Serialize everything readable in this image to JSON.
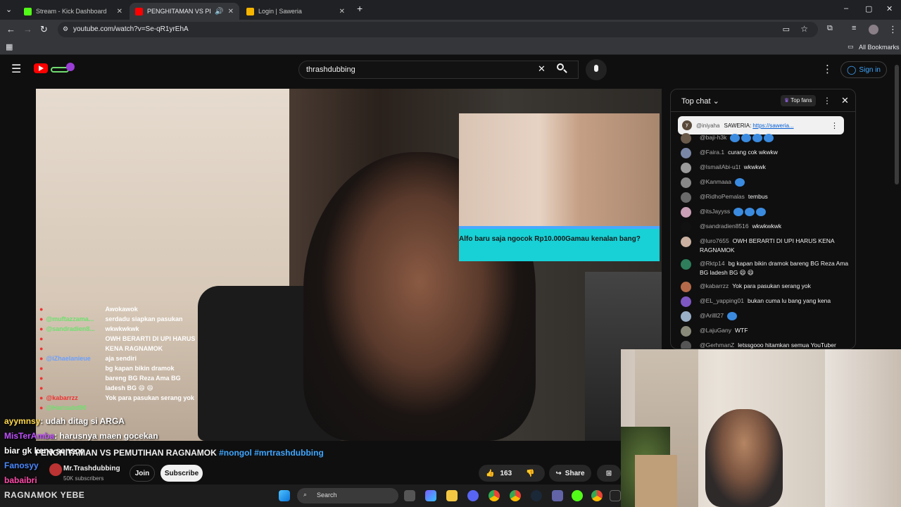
{
  "browser": {
    "tabs": [
      {
        "label": "Stream - Kick Dashboard",
        "color": "#53fc18"
      },
      {
        "label": "PENGHITAMAN VS PEMUTI",
        "color": "#ff0000"
      },
      {
        "label": "Login | Saweria",
        "color": "#f4b400"
      }
    ],
    "url": "youtube.com/watch?v=Se-qR1yrEhA",
    "bookmarks_label": "All Bookmarks"
  },
  "youtube": {
    "search_query": "thrashdubbing",
    "sign_in": "Sign in"
  },
  "video": {
    "alert_message_line1": "Alfo baru saja ngocok Rp10.000",
    "alert_message_line2": "Gamau kenalan bang?",
    "alert_progress_percent": 100,
    "overlay_chat": [
      {
        "user": "",
        "text": "Awokawok",
        "color": "red"
      },
      {
        "user": "@muftazzama...",
        "text": "serdadu siapkan pasukan",
        "color": "green"
      },
      {
        "user": "@sandradien8...",
        "text": "wkwkwkwk",
        "color": "green"
      },
      {
        "user": "",
        "text": "OWH BERARTI DI UPI HARUS",
        "color": "red"
      },
      {
        "user": "",
        "text": "KENA RAGNAMOK",
        "color": "red"
      },
      {
        "user": "@iZhaelanieue",
        "text": "aja sendiri",
        "color": "blue"
      },
      {
        "user": "",
        "text": "bg kapan bikin dramok",
        "color": "red"
      },
      {
        "user": "",
        "text": "bareng BG Reza Ama BG",
        "color": "red"
      },
      {
        "user": "",
        "text": "ladesh BG 😄 😄",
        "color": "red"
      },
      {
        "user": "@kabarrzz",
        "text": "Yok para pasukan serang yok",
        "color": "red"
      },
      {
        "user": "@Harisabd90",
        "text": "",
        "color": "green"
      }
    ],
    "big_chat": [
      {
        "user": "ayymnsy",
        "text": "udah ditag si ARGA"
      },
      {
        "user": "MisTerAmba",
        "text": "harusnya maen gocekan"
      },
      {
        "user": "",
        "text": "biar gk kena sensor"
      },
      {
        "user": "Fanosyy",
        "text": ""
      },
      {
        "user": "babaibri",
        "text": ""
      }
    ],
    "ticker": "RAGNAMOK YEBE"
  },
  "meta": {
    "title": "PENGHITAMAN VS PEMUTIHAN RAGNAMOK",
    "hashtags": "#nongol #mrtrashdubbing",
    "channel": "Mr.Trashdubbing",
    "subscribers": "50K subscribers",
    "join": "Join",
    "subscribe": "Subscribe",
    "likes": "163",
    "share": "Share"
  },
  "chat": {
    "header": "Top chat",
    "top_fans": "Top fans",
    "pinned_user": "@iniyaha",
    "pinned_prefix": "SAWERIA:",
    "pinned_link": "https://saweria...",
    "messages": [
      {
        "user": "@baji-h3k",
        "text": "",
        "emotes": 4,
        "avatar": "#6a5a4a"
      },
      {
        "user": "@Faira.1",
        "text": "curang cok wkwkw",
        "emotes": 0,
        "avatar": "#7a86a6"
      },
      {
        "user": "@IsmailAbi-u1t",
        "text": "wkwkwk",
        "emotes": 0,
        "avatar": "#9a9a9a"
      },
      {
        "user": "@Kanmaaa",
        "text": "",
        "emotes": 1,
        "avatar": "#888"
      },
      {
        "user": "@RidhoPemalas",
        "text": "tembus",
        "emotes": 0,
        "avatar": "#6a6a6a"
      },
      {
        "user": "@itsJayyss",
        "text": "",
        "emotes": 3,
        "avatar": "#c9a0b6"
      },
      {
        "user": "@sandradien8516",
        "text": "wkwkwkwk",
        "emotes": 0,
        "avatar": "#111"
      },
      {
        "user": "@luro7655",
        "text": "OWH BERARTI DI UPI HARUS KENA RAGNAMOK",
        "emotes": 0,
        "avatar": "#c9b0a0"
      },
      {
        "user": "@Rktp14",
        "text": "bg kapan bikin dramok bareng BG Reza Ama BG ladesh BG 😄 😄",
        "emotes": 0,
        "avatar": "#2e7d5b"
      },
      {
        "user": "@kabarrzz",
        "text": "Yok para pasukan serang yok",
        "emotes": 0,
        "avatar": "#b46a4a"
      },
      {
        "user": "@EL_yapping01",
        "text": "bukan cuma lu bang yang kena",
        "emotes": 0,
        "avatar": "#7e57c2"
      },
      {
        "user": "@Arilll27",
        "text": "",
        "emotes": 1,
        "avatar": "#9ab0c8"
      },
      {
        "user": "@LajuGany",
        "text": "WTF",
        "emotes": 0,
        "avatar": "#8a8a7a"
      },
      {
        "user": "@GerhmanZ",
        "text": "letssgooo hitamkan semua YouTuber",
        "emotes": 0,
        "avatar": "#555"
      }
    ]
  },
  "taskbar": {
    "search": "Search"
  }
}
